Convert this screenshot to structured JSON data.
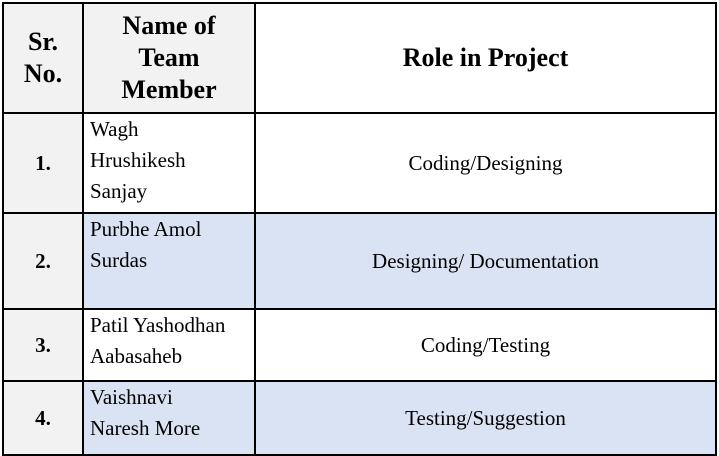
{
  "header": {
    "sr_no": "Sr.\nNo.",
    "name": "Name of\nTeam\nMember",
    "role": "Role in Project"
  },
  "rows": [
    {
      "sr": "1.",
      "name": "Wagh\nHrushikesh\nSanjay",
      "role": "Coding/Designing"
    },
    {
      "sr": "2.",
      "name": "Purbhe Amol\nSurdas",
      "role": "Designing/ Documentation"
    },
    {
      "sr": "3.",
      "name": "Patil Yashodhan\nAabasaheb",
      "role": "Coding/Testing"
    },
    {
      "sr": "4.",
      "name": "Vaishnavi\nNaresh More",
      "role": "Testing/Suggestion"
    }
  ],
  "colors": {
    "header_fill": "#f2f2f2",
    "row_shade": "#dae3f3",
    "border": "#000000"
  }
}
